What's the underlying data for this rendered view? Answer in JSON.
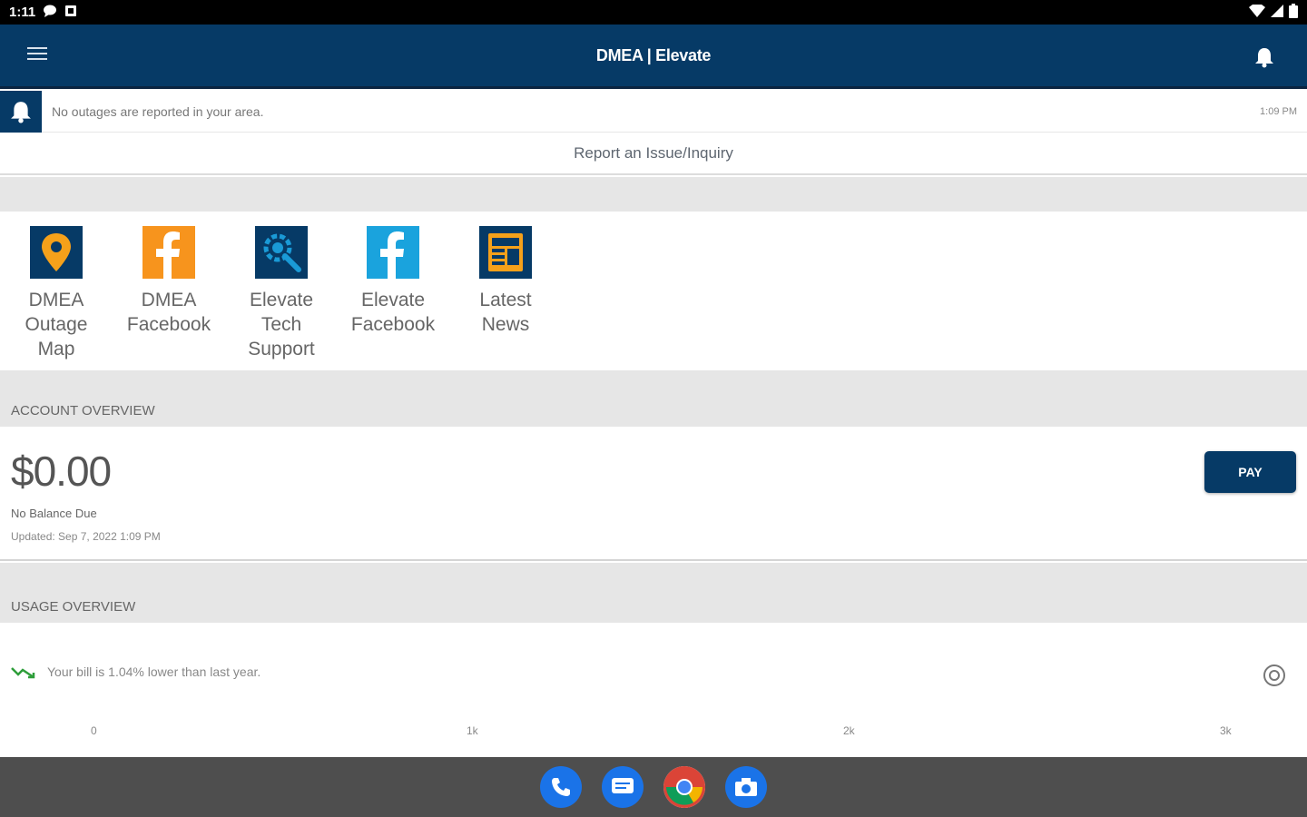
{
  "status_bar": {
    "time": "1:11"
  },
  "app_bar": {
    "title": "DMEA | Elevate",
    "menu_icon": "hamburger-menu-icon",
    "notification_icon": "bell-icon"
  },
  "outage": {
    "message": "No outages are reported in your area.",
    "time": "1:09 PM",
    "icon": "bell-icon"
  },
  "report_link": "Report an Issue/Inquiry",
  "quick_links": [
    {
      "label": "DMEA Outage Map",
      "icon": "map-pin-icon",
      "color": "#f5a11a"
    },
    {
      "label": "DMEA Facebook",
      "icon": "facebook-icon",
      "color": "#f7941d"
    },
    {
      "label": "Elevate Tech Support",
      "icon": "support-gear-icon",
      "color": "#0f6ea8"
    },
    {
      "label": "Elevate Facebook",
      "icon": "facebook-icon",
      "color": "#1aa3dd"
    },
    {
      "label": "Latest News",
      "icon": "newspaper-icon",
      "color": "#f5a11a"
    }
  ],
  "account_overview": {
    "heading": "ACCOUNT OVERVIEW",
    "amount": "$0.00",
    "balance_status": "No Balance Due",
    "updated": "Updated:  Sep 7, 2022 1:09 PM",
    "pay_button": "PAY"
  },
  "usage_overview": {
    "heading": "USAGE OVERVIEW",
    "trend_text": "Your bill is 1.04% lower than last year.",
    "trend_icon": "trend-down-icon",
    "axis_ticks": [
      "0",
      "1k",
      "2k",
      "3k"
    ]
  },
  "nav_dock": [
    {
      "name": "phone-app-icon",
      "color": "#1a73e8"
    },
    {
      "name": "messages-app-icon",
      "color": "#1a73e8"
    },
    {
      "name": "chrome-app-icon",
      "color": "#ffffff"
    },
    {
      "name": "camera-app-icon",
      "color": "#1a73e8"
    }
  ],
  "colors": {
    "primary": "#063a66",
    "background_gray": "#e6e6e6",
    "trend_green": "#2e9e3a"
  }
}
